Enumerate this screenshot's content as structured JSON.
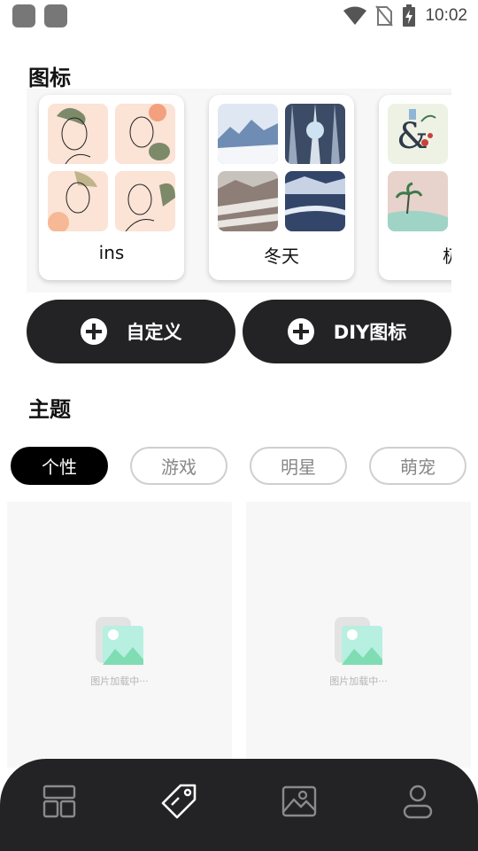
{
  "status_bar": {
    "time": "10:02",
    "icons": [
      "app-notification-icon",
      "app-notification-icon",
      "wifi-icon",
      "no-sim-icon",
      "battery-charging-icon"
    ]
  },
  "icons_section": {
    "title": "图标",
    "packs": [
      {
        "label": "ins"
      },
      {
        "label": "冬天"
      },
      {
        "label": "极"
      }
    ]
  },
  "actions": {
    "custom_label": "自定义",
    "diy_label": "DIY图标"
  },
  "themes_section": {
    "title": "主题",
    "tabs": [
      "个性",
      "游戏",
      "明星",
      "萌宠"
    ],
    "selected_tab": "个性",
    "loading_text": "图片加载中···"
  },
  "bottom_nav": {
    "items": [
      "layout-icon",
      "tag-icon",
      "image-icon",
      "user-icon"
    ],
    "selected": "tag-icon"
  },
  "colors": {
    "dark": "#232325",
    "tab_active": "#000000",
    "card_bg": "#f7f7f7"
  }
}
